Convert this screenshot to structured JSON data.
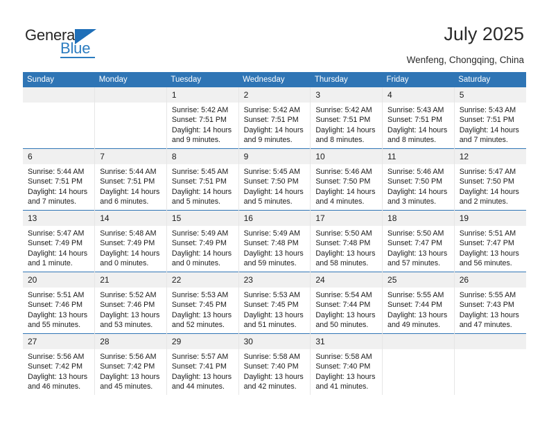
{
  "brand": {
    "name_primary": "General",
    "name_secondary": "Blue",
    "flag_icon": "blue-flag-triangle-icon"
  },
  "header": {
    "title": "July 2025",
    "subtitle": "Wenfeng, Chongqing, China"
  },
  "colors": {
    "header_blue": "#2f75b5",
    "brand_blue": "#2b7cc0",
    "daynum_band": "#f0f0f0",
    "text": "#1a1a1a"
  },
  "calendar": {
    "weekday_headers": [
      "Sunday",
      "Monday",
      "Tuesday",
      "Wednesday",
      "Thursday",
      "Friday",
      "Saturday"
    ],
    "weeks": [
      [
        {
          "day": "",
          "lines": []
        },
        {
          "day": "",
          "lines": []
        },
        {
          "day": "1",
          "lines": [
            "Sunrise: 5:42 AM",
            "Sunset: 7:51 PM",
            "Daylight: 14 hours",
            "and 9 minutes."
          ]
        },
        {
          "day": "2",
          "lines": [
            "Sunrise: 5:42 AM",
            "Sunset: 7:51 PM",
            "Daylight: 14 hours",
            "and 9 minutes."
          ]
        },
        {
          "day": "3",
          "lines": [
            "Sunrise: 5:42 AM",
            "Sunset: 7:51 PM",
            "Daylight: 14 hours",
            "and 8 minutes."
          ]
        },
        {
          "day": "4",
          "lines": [
            "Sunrise: 5:43 AM",
            "Sunset: 7:51 PM",
            "Daylight: 14 hours",
            "and 8 minutes."
          ]
        },
        {
          "day": "5",
          "lines": [
            "Sunrise: 5:43 AM",
            "Sunset: 7:51 PM",
            "Daylight: 14 hours",
            "and 7 minutes."
          ]
        }
      ],
      [
        {
          "day": "6",
          "lines": [
            "Sunrise: 5:44 AM",
            "Sunset: 7:51 PM",
            "Daylight: 14 hours",
            "and 7 minutes."
          ]
        },
        {
          "day": "7",
          "lines": [
            "Sunrise: 5:44 AM",
            "Sunset: 7:51 PM",
            "Daylight: 14 hours",
            "and 6 minutes."
          ]
        },
        {
          "day": "8",
          "lines": [
            "Sunrise: 5:45 AM",
            "Sunset: 7:51 PM",
            "Daylight: 14 hours",
            "and 5 minutes."
          ]
        },
        {
          "day": "9",
          "lines": [
            "Sunrise: 5:45 AM",
            "Sunset: 7:50 PM",
            "Daylight: 14 hours",
            "and 5 minutes."
          ]
        },
        {
          "day": "10",
          "lines": [
            "Sunrise: 5:46 AM",
            "Sunset: 7:50 PM",
            "Daylight: 14 hours",
            "and 4 minutes."
          ]
        },
        {
          "day": "11",
          "lines": [
            "Sunrise: 5:46 AM",
            "Sunset: 7:50 PM",
            "Daylight: 14 hours",
            "and 3 minutes."
          ]
        },
        {
          "day": "12",
          "lines": [
            "Sunrise: 5:47 AM",
            "Sunset: 7:50 PM",
            "Daylight: 14 hours",
            "and 2 minutes."
          ]
        }
      ],
      [
        {
          "day": "13",
          "lines": [
            "Sunrise: 5:47 AM",
            "Sunset: 7:49 PM",
            "Daylight: 14 hours",
            "and 1 minute."
          ]
        },
        {
          "day": "14",
          "lines": [
            "Sunrise: 5:48 AM",
            "Sunset: 7:49 PM",
            "Daylight: 14 hours",
            "and 0 minutes."
          ]
        },
        {
          "day": "15",
          "lines": [
            "Sunrise: 5:49 AM",
            "Sunset: 7:49 PM",
            "Daylight: 14 hours",
            "and 0 minutes."
          ]
        },
        {
          "day": "16",
          "lines": [
            "Sunrise: 5:49 AM",
            "Sunset: 7:48 PM",
            "Daylight: 13 hours",
            "and 59 minutes."
          ]
        },
        {
          "day": "17",
          "lines": [
            "Sunrise: 5:50 AM",
            "Sunset: 7:48 PM",
            "Daylight: 13 hours",
            "and 58 minutes."
          ]
        },
        {
          "day": "18",
          "lines": [
            "Sunrise: 5:50 AM",
            "Sunset: 7:47 PM",
            "Daylight: 13 hours",
            "and 57 minutes."
          ]
        },
        {
          "day": "19",
          "lines": [
            "Sunrise: 5:51 AM",
            "Sunset: 7:47 PM",
            "Daylight: 13 hours",
            "and 56 minutes."
          ]
        }
      ],
      [
        {
          "day": "20",
          "lines": [
            "Sunrise: 5:51 AM",
            "Sunset: 7:46 PM",
            "Daylight: 13 hours",
            "and 55 minutes."
          ]
        },
        {
          "day": "21",
          "lines": [
            "Sunrise: 5:52 AM",
            "Sunset: 7:46 PM",
            "Daylight: 13 hours",
            "and 53 minutes."
          ]
        },
        {
          "day": "22",
          "lines": [
            "Sunrise: 5:53 AM",
            "Sunset: 7:45 PM",
            "Daylight: 13 hours",
            "and 52 minutes."
          ]
        },
        {
          "day": "23",
          "lines": [
            "Sunrise: 5:53 AM",
            "Sunset: 7:45 PM",
            "Daylight: 13 hours",
            "and 51 minutes."
          ]
        },
        {
          "day": "24",
          "lines": [
            "Sunrise: 5:54 AM",
            "Sunset: 7:44 PM",
            "Daylight: 13 hours",
            "and 50 minutes."
          ]
        },
        {
          "day": "25",
          "lines": [
            "Sunrise: 5:55 AM",
            "Sunset: 7:44 PM",
            "Daylight: 13 hours",
            "and 49 minutes."
          ]
        },
        {
          "day": "26",
          "lines": [
            "Sunrise: 5:55 AM",
            "Sunset: 7:43 PM",
            "Daylight: 13 hours",
            "and 47 minutes."
          ]
        }
      ],
      [
        {
          "day": "27",
          "lines": [
            "Sunrise: 5:56 AM",
            "Sunset: 7:42 PM",
            "Daylight: 13 hours",
            "and 46 minutes."
          ]
        },
        {
          "day": "28",
          "lines": [
            "Sunrise: 5:56 AM",
            "Sunset: 7:42 PM",
            "Daylight: 13 hours",
            "and 45 minutes."
          ]
        },
        {
          "day": "29",
          "lines": [
            "Sunrise: 5:57 AM",
            "Sunset: 7:41 PM",
            "Daylight: 13 hours",
            "and 44 minutes."
          ]
        },
        {
          "day": "30",
          "lines": [
            "Sunrise: 5:58 AM",
            "Sunset: 7:40 PM",
            "Daylight: 13 hours",
            "and 42 minutes."
          ]
        },
        {
          "day": "31",
          "lines": [
            "Sunrise: 5:58 AM",
            "Sunset: 7:40 PM",
            "Daylight: 13 hours",
            "and 41 minutes."
          ]
        },
        {
          "day": "",
          "lines": []
        },
        {
          "day": "",
          "lines": []
        }
      ]
    ]
  }
}
